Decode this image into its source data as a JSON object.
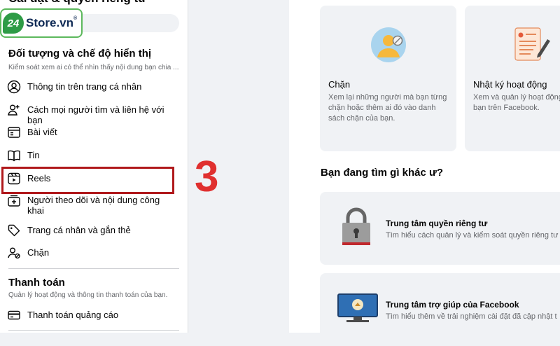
{
  "sidebar": {
    "title": "Cài đặt & quyền riêng tư",
    "logo": {
      "text": "Store.vn",
      "badge": "24",
      "reg": "®"
    },
    "visibility": {
      "heading": "Đối tượng và chế độ hiển thị",
      "subtitle": "Kiểm soát xem ai có thể nhìn thấy nội dung bạn chia ...",
      "items": [
        {
          "label": "Thông tin trên trang cá nhân",
          "icon": "profile-circle-icon"
        },
        {
          "label": "Cách mọi người tìm và liên hệ với bạn",
          "icon": "person-add-icon"
        },
        {
          "label": "Bài viết",
          "icon": "post-icon"
        },
        {
          "label": "Tin",
          "icon": "book-icon"
        },
        {
          "label": "Reels",
          "icon": "reels-icon"
        },
        {
          "label": "Người theo dõi và nội dung công khai",
          "icon": "followers-icon"
        },
        {
          "label": "Trang cá nhân và gắn thẻ",
          "icon": "tag-icon"
        },
        {
          "label": "Chặn",
          "icon": "block-user-icon"
        }
      ]
    },
    "payments": {
      "heading": "Thanh toán",
      "subtitle": "Quản lý hoạt động và thông tin thanh toán của bạn.",
      "items": [
        {
          "label": "Thanh toán quảng cáo",
          "icon": "card-icon"
        }
      ]
    }
  },
  "annotation": {
    "step": "3",
    "highlight_color": "#b0191c",
    "step_color": "#e0302f"
  },
  "main": {
    "cards": [
      {
        "title": "Chặn",
        "description": "Xem lại những người mà bạn từng chặn hoặc thêm ai đó vào danh sách chặn của bạn.",
        "icon": "blocked-person-illustration"
      },
      {
        "title": "Nhật ký hoạt động",
        "description": "Xem và quản lý hoạt động bạn trên Facebook.",
        "icon": "activity-log-illustration"
      }
    ],
    "question": "Bạn đang tìm gì khác ư?",
    "more": [
      {
        "title": "Trung tâm quyền riêng tư",
        "description": "Tìm hiểu cách quản lý và kiểm soát quyền riêng tư",
        "icon": "padlock-illustration"
      },
      {
        "title": "Trung tâm trợ giúp của Facebook",
        "description": "Tìm hiểu thêm về trải nghiệm cài đặt đã cập nhật t",
        "icon": "monitor-illustration"
      }
    ]
  },
  "colors": {
    "background": "#f0f2f5",
    "panel": "#ffffff",
    "text_secondary": "#65676b"
  }
}
